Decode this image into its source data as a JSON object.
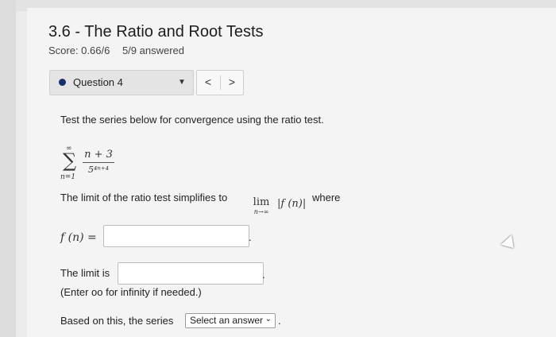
{
  "header": {
    "title": "3.6 - The Ratio and Root Tests",
    "score": "Score: 0.66/6",
    "answered": "5/9 answered"
  },
  "question_nav": {
    "label": "Question 4",
    "dropdown_icon": "caret-down-icon",
    "prev_label": "<",
    "next_label": ">"
  },
  "problem": {
    "prompt": "Test the series below for convergence using the ratio test.",
    "series": {
      "sum_upper": "∞",
      "sum_lower": "n=1",
      "numerator": "n + 3",
      "denominator": "5⁴ⁿ⁺⁴"
    },
    "limit_text": "The limit of the ratio test simplifies to",
    "limit_word": "lim",
    "limit_sub": "n→∞",
    "abs_expr": "|f (n)|",
    "where": "where",
    "fn_label": "f (n) =",
    "fn_value": "",
    "fn_trail": ".",
    "limit_is_label": "The limit is",
    "limit_is_value": "",
    "limit_trail": ".",
    "hint": "(Enter oo for infinity if needed.)",
    "based_text": "Based on this, the series",
    "select_label": "Select an answer",
    "based_trail": "."
  },
  "colors": {
    "page_bg": "#f4f4f4",
    "accent_dot": "#1a2f6b",
    "input_bg": "#ffffff"
  }
}
